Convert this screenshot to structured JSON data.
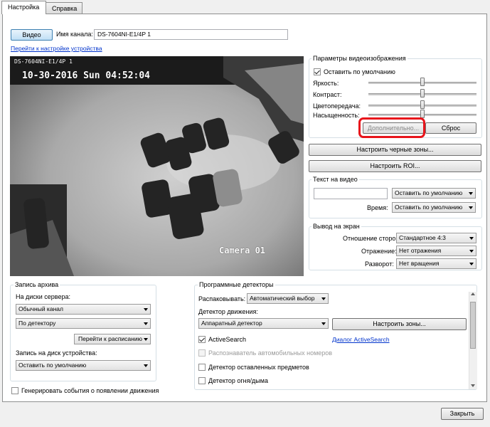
{
  "tabs": {
    "settings": "Настройка",
    "help": "Справка"
  },
  "top": {
    "video_button": "Видео",
    "channel_name_label": "Имя канала:",
    "channel_name_value": "DS-7604NI-E1/4P 1",
    "device_settings_link": "Перейти к настройке устройства"
  },
  "video": {
    "osd_channel": "DS-7604NI-E1/4P 1",
    "osd_datetime": "10-30-2016 Sun 04:52:04",
    "osd_camera": "Camera 01"
  },
  "image_params": {
    "title": "Параметры видеоизображения",
    "default_checkbox": "Оставить по умолчанию",
    "default_checked": true,
    "brightness": "Яркость:",
    "contrast": "Контраст:",
    "color": "Цветопередача:",
    "saturation": "Насыщенность:",
    "brightness_level": 0.5,
    "contrast_level": 0.5,
    "color_level": 0.5,
    "saturation_level": 0.5,
    "more_button": "Дополнительно...",
    "reset_button": "Сброс",
    "highlight_color": "#e8141b"
  },
  "black_zones_button": "Настроить черные зоны...",
  "roi_button": "Настроить ROI...",
  "text_on_video": {
    "title": "Текст на видео",
    "text_value": "",
    "position_select": "Оставить по умолчанию",
    "time_label": "Время:",
    "time_select": "Оставить по умолчанию"
  },
  "screen_output": {
    "title": "Вывод на экран",
    "aspect_label": "Отношение сторон:",
    "aspect_value": "Стандартное 4:3",
    "mirror_label": "Отражение:",
    "mirror_value": "Нет отражения",
    "rotate_label": "Разворот:",
    "rotate_value": "Нет вращения"
  },
  "archive": {
    "title": "Запись архива",
    "server_disks_label": "На диски сервера:",
    "stream_value": "Обычный канал",
    "trigger_value": "По детектору",
    "schedule_button": "Перейти к расписанию",
    "device_disk_label": "Запись на диск устройства:",
    "device_disk_value": "Оставить по умолчанию"
  },
  "motion_events_checkbox": "Генерировать события о появлении движения",
  "detectors": {
    "title": "Программные детекторы",
    "unpack_label": "Распаковывать:",
    "unpack_value": "Автоматический выбор",
    "motion_label": "Детектор движения:",
    "motion_value": "Аппаратный детектор",
    "zones_button": "Настроить зоны...",
    "active_search": "ActiveSearch",
    "active_search_link": "Диалог ActiveSearch",
    "plates": "Распознаватель автомобильных номеров",
    "left_objects": "Детектор оставленных предметов",
    "fire": "Детектор огня/дыма"
  },
  "close_button": "Закрыть"
}
